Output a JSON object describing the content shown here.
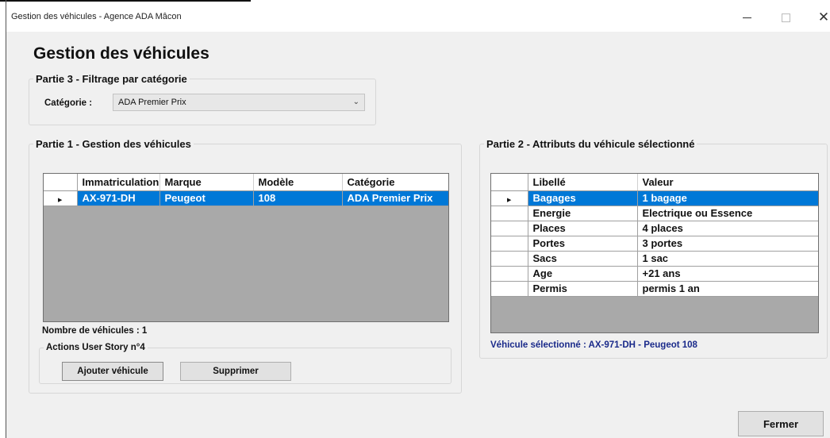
{
  "window": {
    "title": "Gestion des véhicules - Agence ADA Mâcon",
    "minimize_glyph": "—",
    "maximize_glyph": "☐",
    "close_glyph": "✕"
  },
  "heading": "Gestion des véhicules",
  "filter": {
    "group_title": "Partie 3 - Filtrage par catégorie",
    "label": "Catégorie :",
    "selected": "ADA Premier Prix",
    "arrow_icon": "chevron-down-icon"
  },
  "vehicles": {
    "group_title": "Partie 1 - Gestion des véhicules",
    "columns": [
      "Immatriculation",
      "Marque",
      "Modèle",
      "Catégorie"
    ],
    "rows": [
      {
        "immatriculation": "AX-971-DH",
        "marque": "Peugeot",
        "modele": "108",
        "categorie": "ADA Premier Prix",
        "selected": true
      }
    ],
    "count_label": "Nombre de véhicules : 1"
  },
  "actions": {
    "group_title": "Actions User Story n°4",
    "add_label": "Ajouter véhicule",
    "delete_label": "Supprimer"
  },
  "attributes": {
    "group_title": "Partie 2 - Attributs du véhicule sélectionné",
    "columns": [
      "Libellé",
      "Valeur"
    ],
    "rows": [
      {
        "libelle": "Bagages",
        "valeur": "1 bagage",
        "selected": true
      },
      {
        "libelle": "Energie",
        "valeur": "Electrique ou Essence",
        "selected": false
      },
      {
        "libelle": "Places",
        "valeur": "4 places",
        "selected": false
      },
      {
        "libelle": "Portes",
        "valeur": "3 portes",
        "selected": false
      },
      {
        "libelle": "Sacs",
        "valeur": "1 sac",
        "selected": false
      },
      {
        "libelle": "Age",
        "valeur": "+21 ans",
        "selected": false
      },
      {
        "libelle": "Permis",
        "valeur": "permis 1 an",
        "selected": false
      }
    ],
    "selected_label": "Véhicule sélectionné : AX-971-DH - Peugeot 108"
  },
  "close_button": "Fermer",
  "row_marker": "▶",
  "colors": {
    "selection": "#0078d7",
    "grid_bg": "#a9a9a9",
    "status_text": "#1a2a8a"
  }
}
